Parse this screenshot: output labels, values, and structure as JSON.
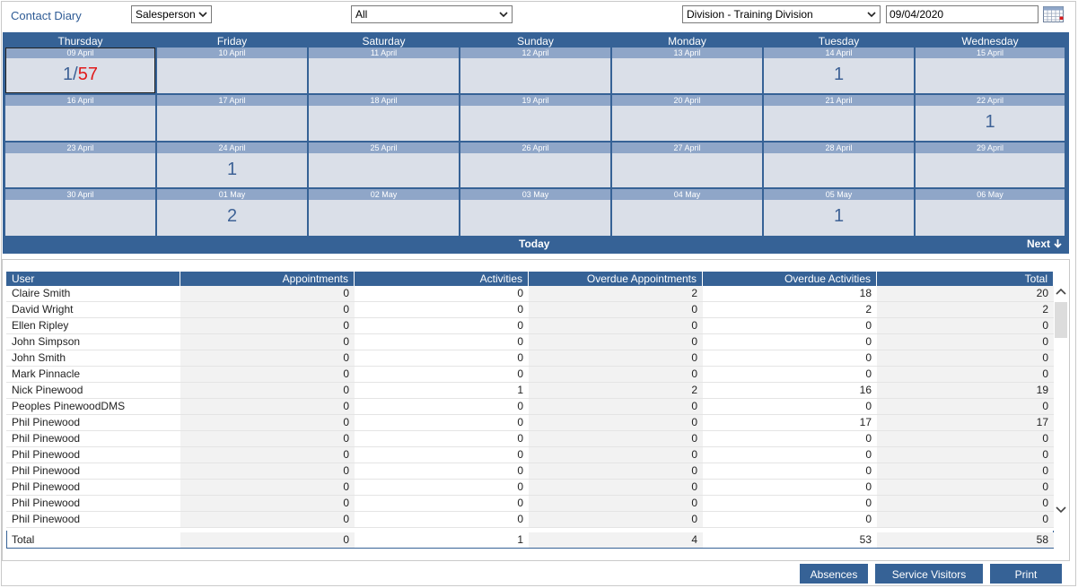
{
  "header": {
    "title": "Contact Diary",
    "filter_type": "Salesperson",
    "filter_user": "All",
    "division": "Division - Training Division",
    "date": "09/04/2020"
  },
  "calendar": {
    "weekdays": [
      "Thursday",
      "Friday",
      "Saturday",
      "Sunday",
      "Monday",
      "Tuesday",
      "Wednesday"
    ],
    "weeks": [
      [
        {
          "date": "09 April",
          "count": "1",
          "overdue": "57"
        },
        {
          "date": "10 April",
          "count": ""
        },
        {
          "date": "11 April",
          "count": ""
        },
        {
          "date": "12 April",
          "count": ""
        },
        {
          "date": "13 April",
          "count": ""
        },
        {
          "date": "14 April",
          "count": "1"
        },
        {
          "date": "15 April",
          "count": ""
        }
      ],
      [
        {
          "date": "16 April",
          "count": ""
        },
        {
          "date": "17 April",
          "count": ""
        },
        {
          "date": "18 April",
          "count": ""
        },
        {
          "date": "19 April",
          "count": ""
        },
        {
          "date": "20 April",
          "count": ""
        },
        {
          "date": "21 April",
          "count": ""
        },
        {
          "date": "22 April",
          "count": "1"
        }
      ],
      [
        {
          "date": "23 April",
          "count": ""
        },
        {
          "date": "24 April",
          "count": "1"
        },
        {
          "date": "25 April",
          "count": ""
        },
        {
          "date": "26 April",
          "count": ""
        },
        {
          "date": "27 April",
          "count": ""
        },
        {
          "date": "28 April",
          "count": ""
        },
        {
          "date": "29 April",
          "count": ""
        }
      ],
      [
        {
          "date": "30 April",
          "count": ""
        },
        {
          "date": "01 May",
          "count": "2"
        },
        {
          "date": "02 May",
          "count": ""
        },
        {
          "date": "03 May",
          "count": ""
        },
        {
          "date": "04 May",
          "count": ""
        },
        {
          "date": "05 May",
          "count": "1"
        },
        {
          "date": "06 May",
          "count": ""
        }
      ]
    ],
    "today_label": "Today",
    "next_label": "Next"
  },
  "table": {
    "columns": [
      "User",
      "Appointments",
      "Activities",
      "Overdue Appointments",
      "Overdue Activities",
      "Total"
    ],
    "rows": [
      [
        "Claire Smith",
        "0",
        "0",
        "2",
        "18",
        "20"
      ],
      [
        "David Wright",
        "0",
        "0",
        "0",
        "2",
        "2"
      ],
      [
        "Ellen Ripley",
        "0",
        "0",
        "0",
        "0",
        "0"
      ],
      [
        "John Simpson",
        "0",
        "0",
        "0",
        "0",
        "0"
      ],
      [
        "John Smith",
        "0",
        "0",
        "0",
        "0",
        "0"
      ],
      [
        "Mark Pinnacle",
        "0",
        "0",
        "0",
        "0",
        "0"
      ],
      [
        "Nick Pinewood",
        "0",
        "1",
        "2",
        "16",
        "19"
      ],
      [
        "Peoples PinewoodDMS",
        "0",
        "0",
        "0",
        "0",
        "0"
      ],
      [
        "Phil Pinewood",
        "0",
        "0",
        "0",
        "17",
        "17"
      ],
      [
        "Phil Pinewood",
        "0",
        "0",
        "0",
        "0",
        "0"
      ],
      [
        "Phil Pinewood",
        "0",
        "0",
        "0",
        "0",
        "0"
      ],
      [
        "Phil Pinewood",
        "0",
        "0",
        "0",
        "0",
        "0"
      ],
      [
        "Phil Pinewood",
        "0",
        "0",
        "0",
        "0",
        "0"
      ],
      [
        "Phil Pinewood",
        "0",
        "0",
        "0",
        "0",
        "0"
      ],
      [
        "Phil Pinewood",
        "0",
        "0",
        "0",
        "0",
        "0"
      ]
    ],
    "total": [
      "Total",
      "0",
      "1",
      "4",
      "53",
      "58"
    ]
  },
  "footer": {
    "absences_label": "Absences",
    "service_visitors_label": "Service Visitors",
    "print_label": "Print"
  },
  "colors": {
    "accent": "#366296",
    "overdue": "#e11a1a"
  }
}
